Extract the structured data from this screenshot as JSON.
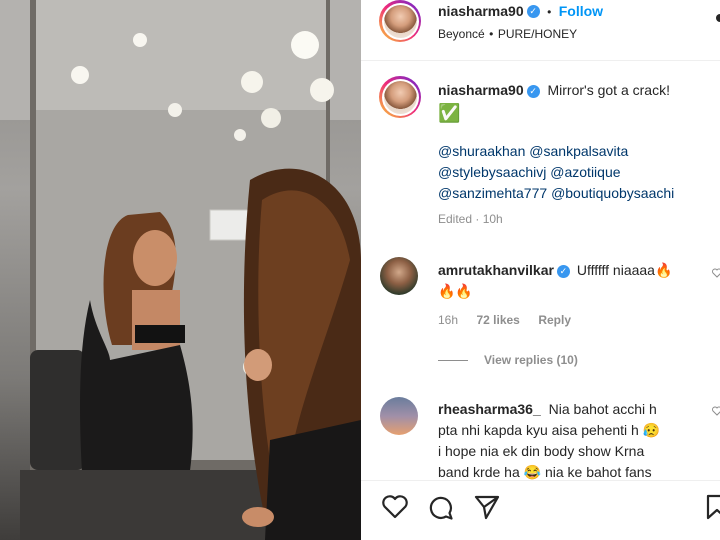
{
  "post": {
    "username": "niasharma90",
    "follow_label": "Follow",
    "separator": "•",
    "audio": {
      "artist": "Beyoncé",
      "sep": "•",
      "track": "PURE/HONEY"
    }
  },
  "caption": {
    "username": "niasharma90",
    "text": "Mirror's got a crack!",
    "check_emoji": "✅",
    "mentions_line1": [
      "@shuraakhan",
      "@sankpalsavita"
    ],
    "mentions_line2": [
      "@stylebysaachivj",
      "@azotiique"
    ],
    "mentions_line3": [
      "@sanzimehta777",
      "@boutiquobysaachi"
    ],
    "meta": "Edited · 10h"
  },
  "comments": [
    {
      "username": "amrutakhanvilkar",
      "text": "Uffffff niaaaa🔥",
      "text_line2": "🔥🔥",
      "time": "16h",
      "likes": "72 likes",
      "reply_label": "Reply",
      "view_replies": "View replies (10)"
    },
    {
      "username": "rheasharma36_",
      "line1": "Nia bahot acchi h",
      "line2": "pta nhi kapda kyu aisa pehenti h 😥",
      "line3": "i hope nia ek din body show Krna",
      "line4": "band krde ha 😂 nia ke bahot fans"
    }
  ],
  "actions": [
    "heart-icon",
    "comment-icon",
    "share-icon",
    "save-icon"
  ],
  "colors": {
    "link_blue": "#0095f6",
    "mention_blue": "#00376b",
    "verified_blue": "#3897f0",
    "text": "#262626",
    "muted": "#8e8e8e"
  }
}
